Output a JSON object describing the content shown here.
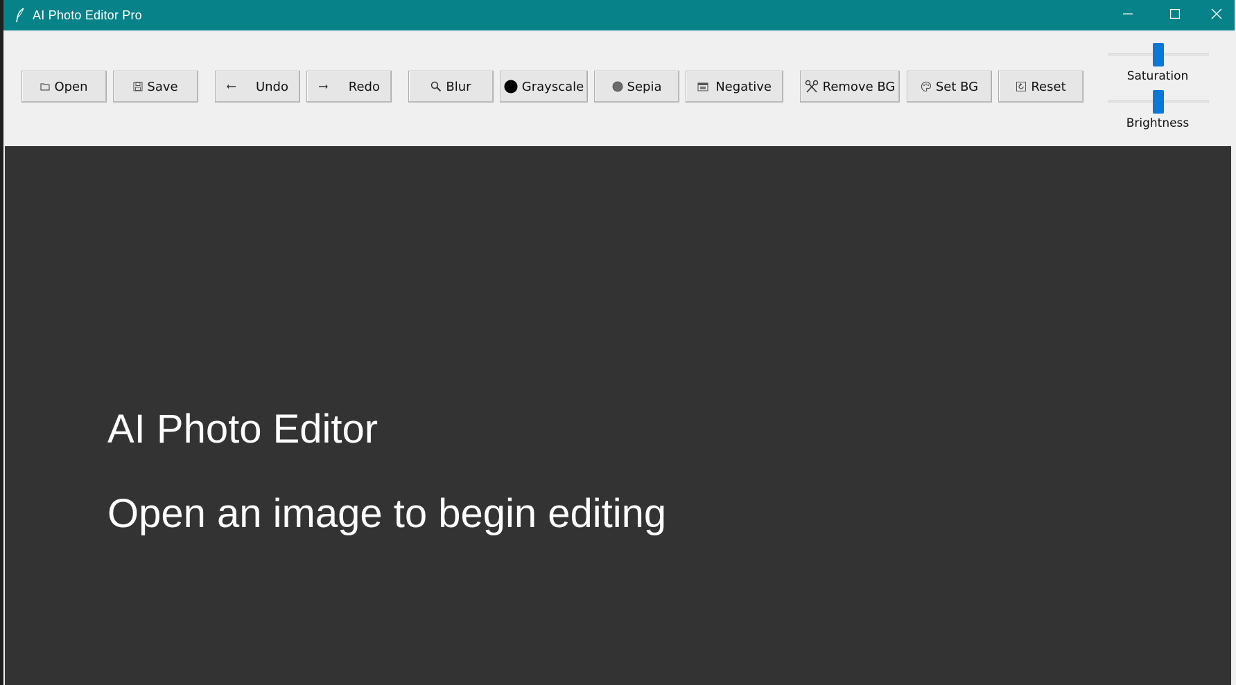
{
  "window": {
    "title": "AI Photo Editor Pro",
    "titlebar_color": "#078288",
    "controls": [
      "minimize-icon",
      "maximize-icon",
      "close-icon"
    ]
  },
  "toolbar": {
    "buttons": [
      {
        "id": "open",
        "label": "Open",
        "icon": "folder-icon"
      },
      {
        "id": "save",
        "label": "Save",
        "icon": "floppy-disk-icon"
      },
      {
        "id": "undo",
        "label": "Undo",
        "icon": "undo-arrow-icon"
      },
      {
        "id": "redo",
        "label": "Redo",
        "icon": "redo-arrow-icon"
      },
      {
        "id": "blur",
        "label": "Blur",
        "icon": "magnifier-icon"
      },
      {
        "id": "grayscale",
        "label": "Grayscale",
        "icon": "black-circle-icon"
      },
      {
        "id": "sepia",
        "label": "Sepia",
        "icon": "brown-circle-icon"
      },
      {
        "id": "negative",
        "label": "Negative",
        "icon": "film-frame-icon"
      },
      {
        "id": "remove_bg",
        "label": "Remove BG",
        "icon": "scissors-icon"
      },
      {
        "id": "set_bg",
        "label": "Set BG",
        "icon": "palette-icon"
      },
      {
        "id": "reset",
        "label": "Reset",
        "icon": "reset-icon"
      }
    ]
  },
  "sliders": {
    "saturation": {
      "label": "Saturation",
      "value_fraction": 0.5
    },
    "brightness": {
      "label": "Brightness",
      "value_fraction": 0.5
    },
    "thumb_color": "#0a78d7"
  },
  "canvas": {
    "background": "#333333",
    "heading": "AI Photo Editor",
    "message": "Open an image to begin editing"
  }
}
